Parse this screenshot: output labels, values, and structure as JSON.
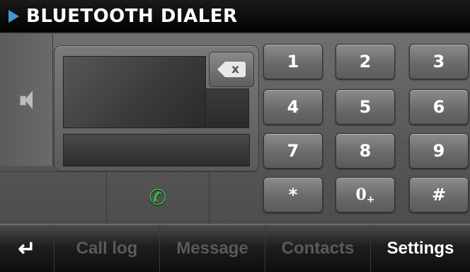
{
  "header": {
    "title": "BLUETOOTH DIALER"
  },
  "display": {
    "number": "",
    "name": "",
    "backspace_label": "x"
  },
  "keypad": {
    "keys": [
      "1",
      "2",
      "3",
      "4",
      "5",
      "6",
      "7",
      "8",
      "9",
      "*",
      "0",
      "#"
    ],
    "zero_sub": "+"
  },
  "bottom_nav": {
    "back_icon": "return-arrow-icon",
    "items": [
      {
        "label": "Call log",
        "enabled": false
      },
      {
        "label": "Message",
        "enabled": false
      },
      {
        "label": "Contacts",
        "enabled": false
      },
      {
        "label": "Settings",
        "enabled": true
      }
    ]
  },
  "colors": {
    "accent": "#3e9bd6",
    "call_green": "#3fbf4a",
    "disabled_text": "#5a5a5a"
  }
}
